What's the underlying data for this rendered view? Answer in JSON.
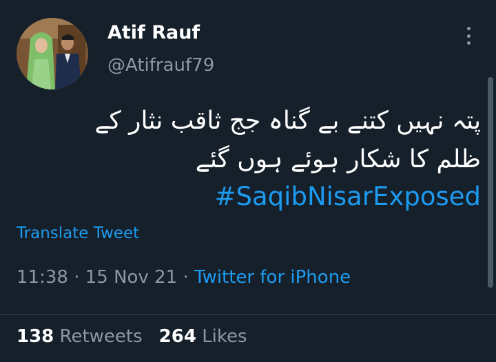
{
  "author": {
    "name": "Atif Rauf",
    "handle": "@Atifrauf79"
  },
  "tweet": {
    "line1": "پتہ نہیں کتنے بے گناہ جج ثاقب نثار کے",
    "line2": "ظلم کا شکار ہوئے ہوں گئے",
    "hashtag": "#SaqibNisarExposed"
  },
  "actions": {
    "translate": "Translate Tweet"
  },
  "meta": {
    "time": "11:38",
    "sep1": " · ",
    "date": "15 Nov 21",
    "sep2": " · ",
    "source": "Twitter for iPhone"
  },
  "stats": {
    "retweets_count": "138",
    "retweets_label": "Retweets",
    "likes_count": "264",
    "likes_label": "Likes"
  },
  "colors": {
    "background": "#15202b",
    "accent": "#1d9bf0",
    "secondary_text": "#8b98a5"
  },
  "icons": {
    "more": "more-vertical-icon"
  }
}
